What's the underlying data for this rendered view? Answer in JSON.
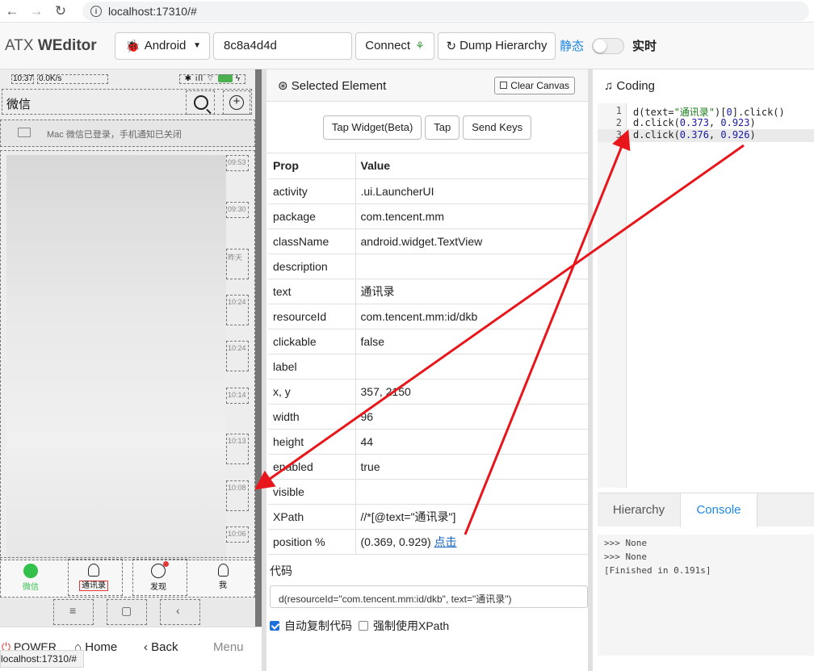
{
  "browser": {
    "url": "localhost:17310/#"
  },
  "header": {
    "brand_light": "ATX",
    "brand_bold": "WEditor",
    "platform": "Android",
    "serial": "8c8a4d4d",
    "connect_label": "Connect",
    "dump_label": "Dump Hierarchy",
    "static_label": "静态",
    "realtime_label": "实时"
  },
  "phone": {
    "status_time": "10:37",
    "status_speed": "0.0K/s",
    "title": "微信",
    "notice": "Mac 微信已登录，手机通知已关闭",
    "chat_times": [
      "09:53",
      "09:30",
      "昨天",
      "10:24",
      "10:24",
      "10:14",
      "10:13",
      "10:08",
      "10:06"
    ],
    "tabs": [
      "微信",
      "通讯录",
      "发现",
      "我"
    ],
    "nav": [
      "≡",
      "▢",
      "‹"
    ],
    "actions": {
      "power": "POWER",
      "home": "Home",
      "back": "Back",
      "menu": "Menu"
    },
    "status_url": "localhost:17310/#"
  },
  "selected": {
    "title": "Selected Element",
    "clear_label": "Clear Canvas",
    "buttons": [
      "Tap Widget(Beta)",
      "Tap",
      "Send Keys"
    ],
    "headers": {
      "prop": "Prop",
      "value": "Value"
    },
    "rows": [
      {
        "prop": "activity",
        "value": ".ui.LauncherUI"
      },
      {
        "prop": "package",
        "value": "com.tencent.mm"
      },
      {
        "prop": "className",
        "value": "android.widget.TextView"
      },
      {
        "prop": "description",
        "value": ""
      },
      {
        "prop": "text",
        "value": "通讯录"
      },
      {
        "prop": "resourceId",
        "value": "com.tencent.mm:id/dkb"
      },
      {
        "prop": "clickable",
        "value": "false"
      },
      {
        "prop": "label",
        "value": ""
      },
      {
        "prop": "x, y",
        "value": "357, 2150"
      },
      {
        "prop": "width",
        "value": "96"
      },
      {
        "prop": "height",
        "value": "44"
      },
      {
        "prop": "enabled",
        "value": "true"
      },
      {
        "prop": "visible",
        "value": ""
      },
      {
        "prop": "XPath",
        "value": "//*[@text=\"通讯录\"]"
      }
    ],
    "position": {
      "prop": "position %",
      "value": "(0.369, 0.929)",
      "link": "点击"
    },
    "code_label": "代码",
    "code": "d(resourceId=\"com.tencent.mm:id/dkb\", text=\"通讯录\")",
    "auto_copy_label": "自动复制代码",
    "force_xpath_label": "强制使用XPath"
  },
  "coding": {
    "title": "Coding",
    "lines": [
      {
        "num": "1",
        "pre": "d(text=",
        "str": "\"通讯录\"",
        "mid": ")[",
        "n1": "0",
        "post": "].click()"
      },
      {
        "num": "2",
        "pre": "d.click(",
        "n1": "0.373",
        "sep": ", ",
        "n2": "0.923",
        "post": ")"
      },
      {
        "num": "3",
        "pre": "d.click(",
        "n1": "0.376",
        "sep": ", ",
        "n2": "0.926",
        "post": ")"
      }
    ],
    "tabs": {
      "hierarchy": "Hierarchy",
      "console": "Console"
    },
    "console": [
      ">>> None",
      ">>> None",
      "[Finished in 0.191s]"
    ]
  },
  "colors": {
    "accent": "#1e88e5",
    "arrow": "#e8161b",
    "wechat_green": "#33c14c"
  }
}
